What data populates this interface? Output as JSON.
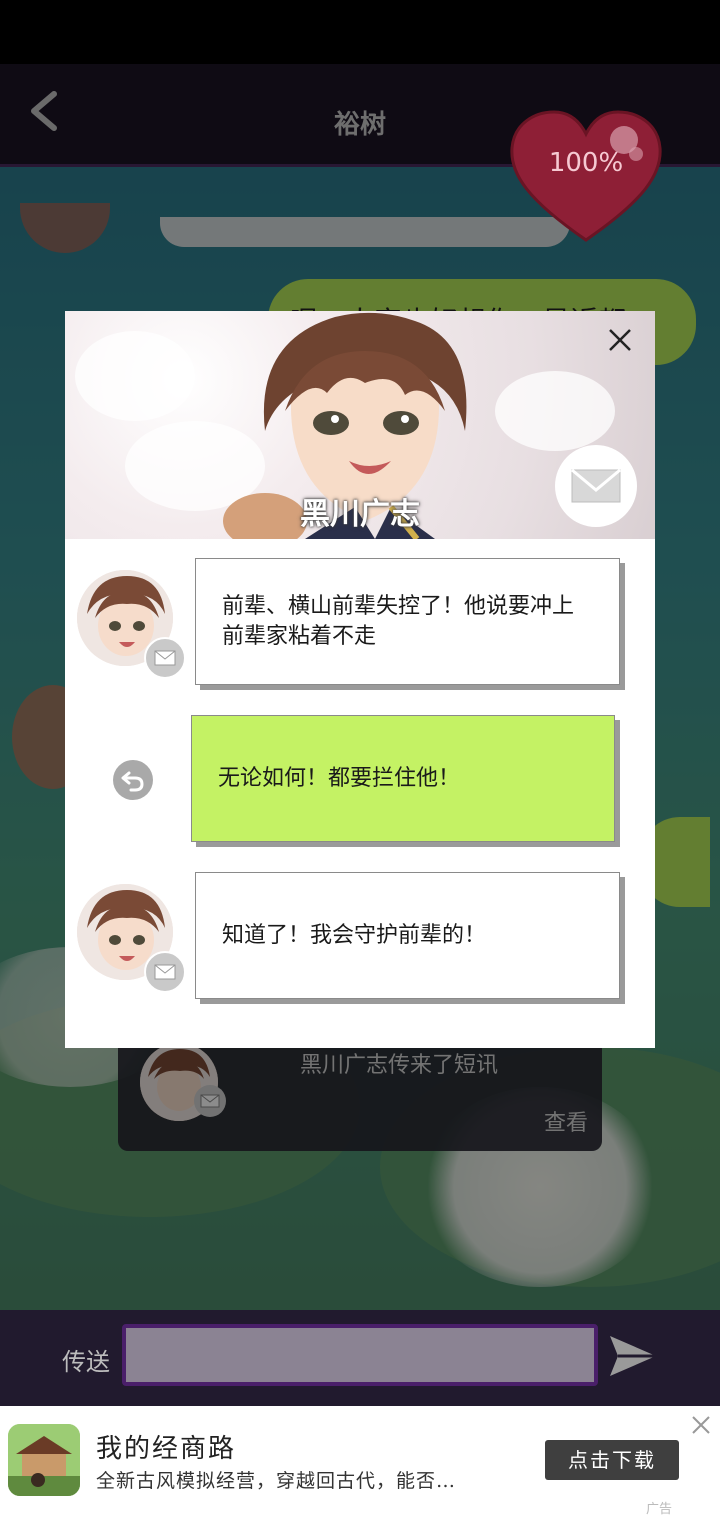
{
  "chat": {
    "title": "裕树",
    "back_icon": "chevron-left-icon",
    "heart_meter": "100%",
    "visible_message": "嗯，人家也好想你。最近都"
  },
  "notification": {
    "text": "黑川广志传来了短讯",
    "view_label": "查看"
  },
  "input_bar": {
    "label": "传送",
    "placeholder": "",
    "send_icon": "send-arrow-icon"
  },
  "modal": {
    "contact_name": "黑川广志",
    "close_icon": "close-x-icon",
    "mail_icon": "envelope-icon",
    "messages": [
      {
        "from": "contact",
        "text": "前辈、横山前辈失控了！他说要冲上前辈家粘着不走"
      },
      {
        "from": "player",
        "text": "无论如何！都要拦住他！"
      },
      {
        "from": "contact",
        "text": "知道了！我会守护前辈的！"
      }
    ],
    "reply_icon": "undo-arrow-icon"
  },
  "ad": {
    "title": "我的经商路",
    "description": "全新古风模拟经营，穿越回古代，能否…",
    "cta": "点击下载",
    "tag": "广告",
    "close_icon": "close-icon"
  },
  "colors": {
    "header_bg": "#1c1426",
    "green_bubble": "#c4f264",
    "input_border": "#4a1f6a",
    "heart": "#c8314f"
  }
}
